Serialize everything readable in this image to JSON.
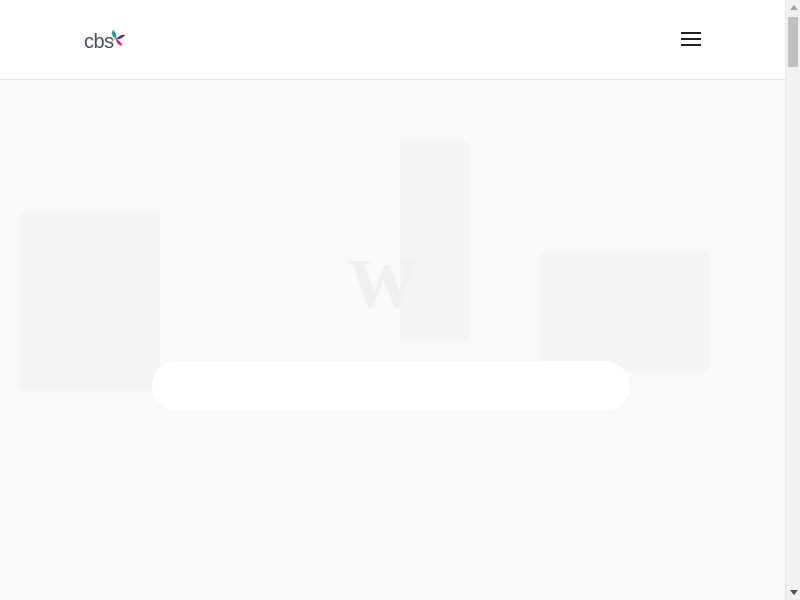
{
  "header": {
    "logo_text": "cbs",
    "logo_colors": {
      "teal": "#1aa39a",
      "purple": "#5b2a82",
      "pink": "#d6246e",
      "green": "#7cb342"
    },
    "menu_icon": "hamburger-menu-icon"
  },
  "hero": {
    "search_text": "",
    "cta_text": ""
  },
  "scrollbar": {
    "up_icon": "scroll-up-arrow-icon",
    "down_icon": "scroll-down-arrow-icon"
  }
}
